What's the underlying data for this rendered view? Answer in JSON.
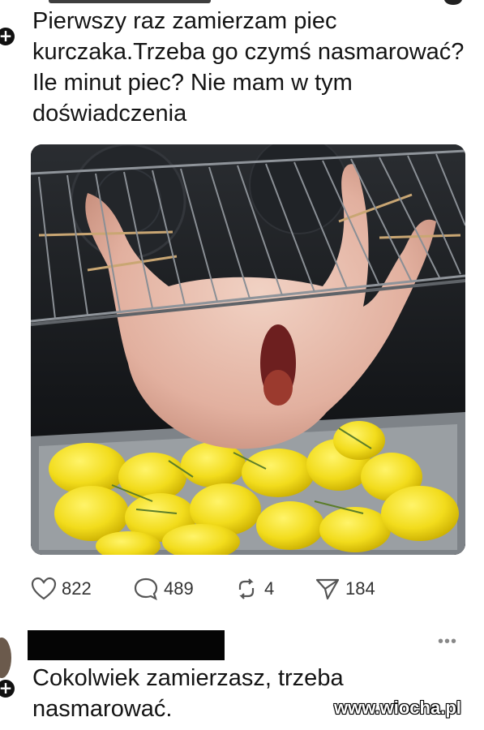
{
  "post": {
    "text": "Pierwszy raz zamierzam piec kurczaka.Trzeba go czymś nasmarować? Ile minut piec? Nie mam w tym doświadczenia",
    "avatar_badge": "+"
  },
  "media": {
    "icon": "photo-chicken-in-oven"
  },
  "actions": {
    "likes": "822",
    "replies": "489",
    "reposts": "4",
    "shares": "184"
  },
  "reply": {
    "text": "Cokolwiek zamierzasz, trzeba nasmarować.",
    "more": "•••",
    "avatar_badge": "+"
  },
  "watermark": "www.wiocha.pl"
}
